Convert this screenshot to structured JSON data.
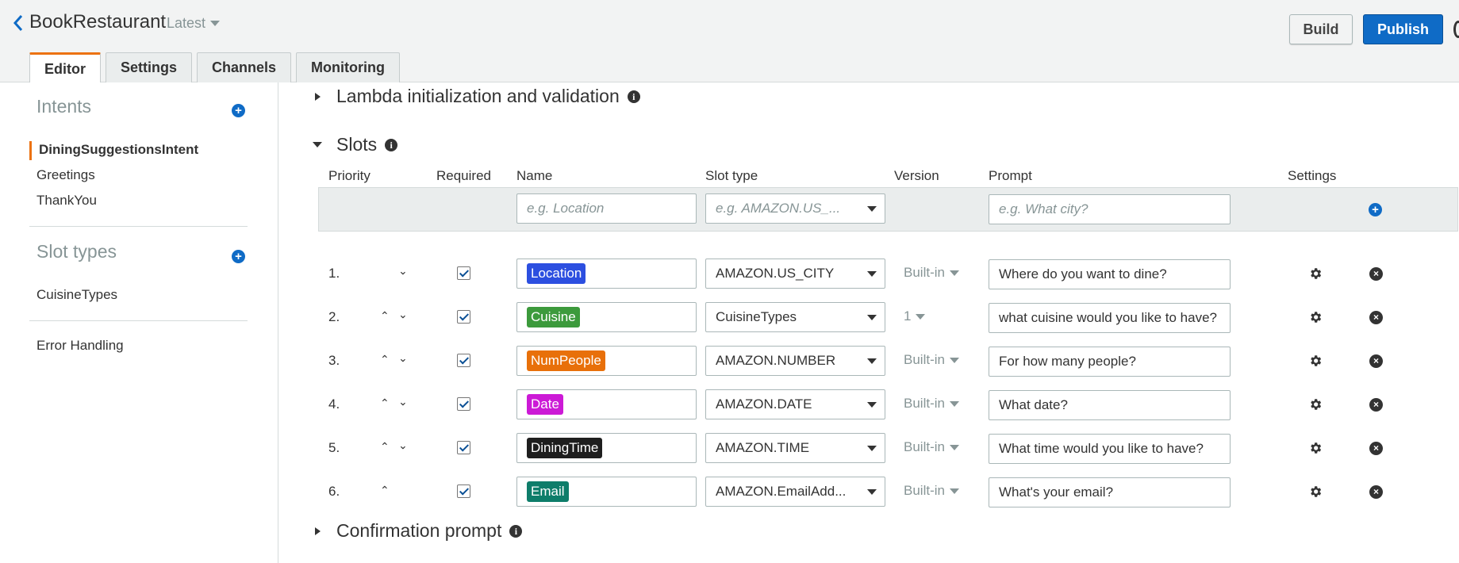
{
  "header": {
    "bot_name": "BookRestaurant",
    "version": "Latest",
    "build_label": "Build",
    "publish_label": "Publish"
  },
  "tabs": [
    {
      "label": "Editor",
      "active": true
    },
    {
      "label": "Settings",
      "active": false
    },
    {
      "label": "Channels",
      "active": false
    },
    {
      "label": "Monitoring",
      "active": false
    }
  ],
  "sidebar": {
    "intents_heading": "Intents",
    "intents": [
      "DiningSuggestionsIntent",
      "Greetings",
      "ThankYou"
    ],
    "slot_types_heading": "Slot types",
    "slot_types": [
      "CuisineTypes"
    ],
    "error_handling": "Error Handling"
  },
  "main": {
    "lambda_section": "Lambda initialization and validation",
    "slots_section": "Slots",
    "confirmation_section": "Confirmation prompt",
    "columns": {
      "priority": "Priority",
      "required": "Required",
      "name": "Name",
      "slot_type": "Slot type",
      "version": "Version",
      "prompt": "Prompt",
      "settings": "Settings"
    },
    "new_slot": {
      "name_placeholder": "e.g. Location",
      "type_placeholder": "e.g. AMAZON.US_...",
      "prompt_placeholder": "e.g. What city?"
    },
    "slots": [
      {
        "priority": "1.",
        "name": "Location",
        "color": "#2c4fe0",
        "type": "AMAZON.US_CITY",
        "version": "Built-in",
        "prompt": "Where do you want to dine?"
      },
      {
        "priority": "2.",
        "name": "Cuisine",
        "color": "#3c9a3c",
        "type": "CuisineTypes",
        "version": "1",
        "prompt": "what cuisine would you like to have?"
      },
      {
        "priority": "3.",
        "name": "NumPeople",
        "color": "#e8700a",
        "type": "AMAZON.NUMBER",
        "version": "Built-in",
        "prompt": "For how many people?"
      },
      {
        "priority": "4.",
        "name": "Date",
        "color": "#cc1ad6",
        "type": "AMAZON.DATE",
        "version": "Built-in",
        "prompt": "What date?"
      },
      {
        "priority": "5.",
        "name": "DiningTime",
        "color": "#1e1e1e",
        "type": "AMAZON.TIME",
        "version": "Built-in",
        "prompt": "What time would you like to have?"
      },
      {
        "priority": "6.",
        "name": "Email",
        "color": "#0e7d6a",
        "type": "AMAZON.EmailAdd...",
        "version": "Built-in",
        "prompt": "What's your email?"
      }
    ]
  }
}
